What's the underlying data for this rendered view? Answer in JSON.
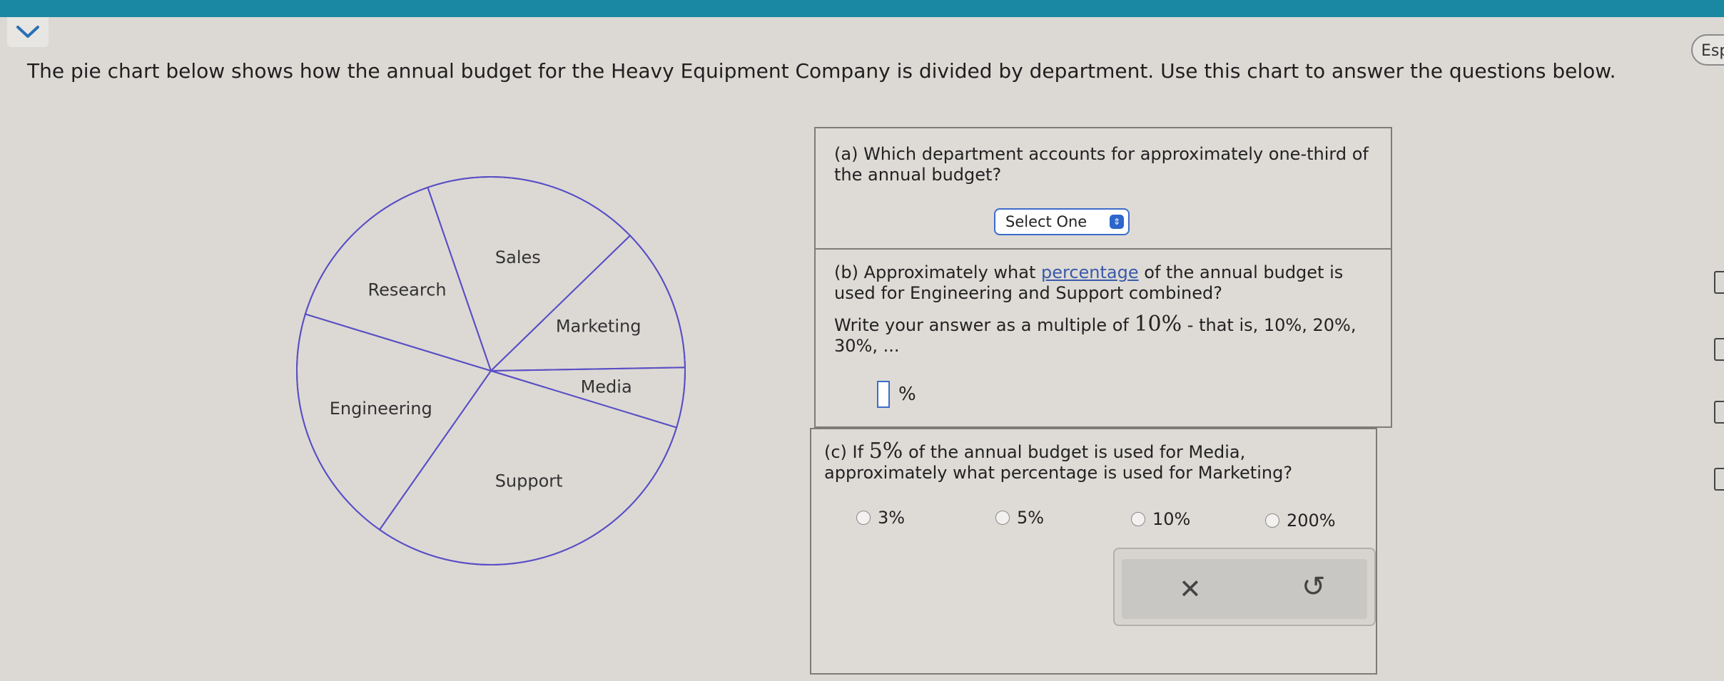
{
  "header": {
    "intro_text": "The pie chart below shows how the annual budget for the Heavy Equipment Company is divided by department. Use this chart to answer the questions below.",
    "language_button": "Esp",
    "chevron_icon": "chevron-down-icon"
  },
  "chart_data": {
    "type": "pie",
    "categories": [
      "Sales",
      "Marketing",
      "Media",
      "Support",
      "Engineering",
      "Research"
    ],
    "values": [
      18,
      12,
      5,
      30,
      20,
      15
    ],
    "unit": "percent (approximate)",
    "title": "",
    "stroke_color": "#5a4fc4"
  },
  "questions": {
    "a": {
      "prompt": "(a) Which department accounts for approximately one-third of the annual budget?",
      "select_label": "Select One"
    },
    "b": {
      "prompt_before_link": "(b) Approximately what ",
      "link_text": "percentage",
      "prompt_after_link": " of the annual budget is used for Engineering and Support combined?",
      "instruction_before": "Write your answer as a multiple of ",
      "instruction_math": "10%",
      "instruction_after": " - that is, 10%, 20%, 30%, ...",
      "input_value": "",
      "unit": "%"
    },
    "c": {
      "prompt_before": "(c) If ",
      "prompt_math": "5%",
      "prompt_after": " of the annual budget is used for Media, approximately what percentage is used for Marketing?",
      "options": [
        "3%",
        "5%",
        "10%",
        "200%"
      ]
    }
  },
  "actions": {
    "clear_symbol": "✕",
    "undo_symbol": "↺"
  },
  "colors": {
    "top_bar": "#1a88a2",
    "select_border": "#3d6cc9",
    "link": "#3a5aa8"
  }
}
